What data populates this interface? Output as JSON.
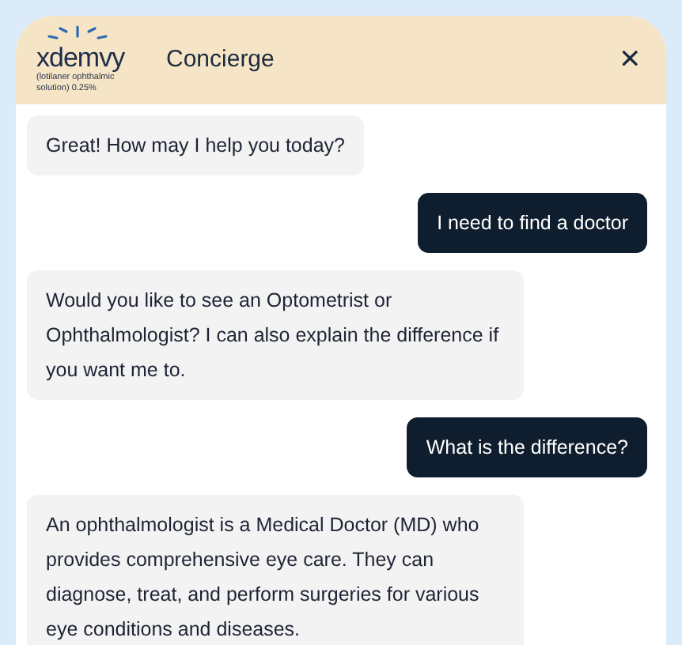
{
  "header": {
    "logo": {
      "wordmark": "xdemvy",
      "subtitle": "(lotilaner ophthalmic solution) 0.25%"
    },
    "title": "Concierge",
    "close": "✕"
  },
  "messages": [
    {
      "kind": "bot",
      "text": "Great! How may I help you today?"
    },
    {
      "kind": "user",
      "text": "I need to find a doctor"
    },
    {
      "kind": "bot",
      "text": "Would you like to see an Optometrist or Ophthalmologist? I can also explain the difference if you want me to."
    },
    {
      "kind": "user",
      "text": "What is the difference?"
    },
    {
      "kind": "bot",
      "text": "An ophthalmologist is a Medical Doctor (MD) who provides comprehensive eye care. They can diagnose, treat, and perform surgeries for various eye conditions and diseases."
    }
  ]
}
